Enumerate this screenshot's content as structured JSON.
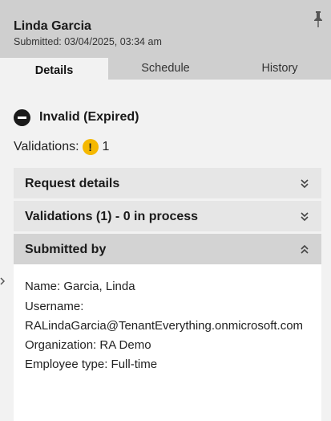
{
  "header": {
    "name": "Linda Garcia",
    "submitted": "Submitted: 03/04/2025, 03:34 am"
  },
  "tabs": [
    {
      "label": "Details",
      "active": true
    },
    {
      "label": "Schedule",
      "active": false
    },
    {
      "label": "History",
      "active": false
    }
  ],
  "status": {
    "text": "Invalid (Expired)",
    "icon": "blocked-icon"
  },
  "validations": {
    "label": "Validations:",
    "count": "1",
    "icon": "warning-icon",
    "icon_color": "#f5b800"
  },
  "sections": [
    {
      "label": "Request details",
      "expanded": false
    },
    {
      "label": "Validations (1) - 0 in process",
      "expanded": false
    },
    {
      "label": "Submitted by",
      "expanded": true
    }
  ],
  "submitted_by": {
    "name_line": "Name: Garcia, Linda",
    "username_label": "Username:",
    "username_value": "RALindaGarcia@TenantEverything.onmicrosoft.com",
    "organization_line": "Organization: RA Demo",
    "employee_type_line": "Employee type: Full-time"
  },
  "colors": {
    "header_bg": "#cfcfcf",
    "page_bg": "#f2f2f2",
    "warning": "#f5b800"
  }
}
